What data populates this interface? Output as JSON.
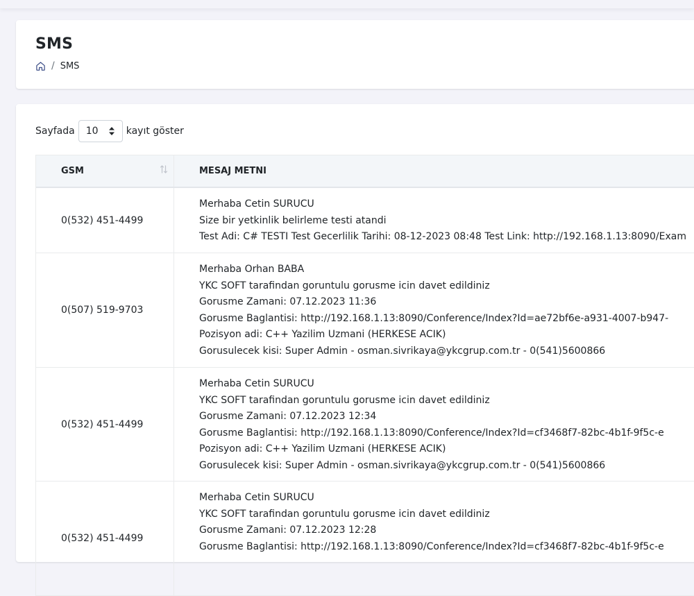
{
  "header": {
    "title": "SMS",
    "breadcrumb": [
      "SMS"
    ]
  },
  "length_menu": {
    "prefix": "Sayfada",
    "selected": "10",
    "suffix": "kayıt göster"
  },
  "table": {
    "columns": [
      "GSM",
      "MESAJ METNI"
    ],
    "rows": [
      {
        "gsm": "0(532) 451-4499",
        "lines": [
          "Merhaba Cetin SURUCU",
          "Size bir yetkinlik belirleme testi atandi",
          "Test Adi: C# TESTI Test Gecerlilik Tarihi: 08-12-2023 08:48 Test Link: http://192.168.1.13:8090/Exam"
        ]
      },
      {
        "gsm": "0(507) 519-9703",
        "lines": [
          "Merhaba Orhan BABA",
          "YKC SOFT tarafindan goruntulu gorusme icin davet edildiniz",
          "Gorusme Zamani: 07.12.2023 11:36",
          "Gorusme Baglantisi: http://192.168.1.13:8090/Conference/Index?Id=ae72bf6e-a931-4007-b947-",
          "Pozisyon adi: C++ Yazilim Uzmani (HERKESE ACIK)",
          "Gorusulecek kisi: Super Admin - osman.sivrikaya@ykcgrup.com.tr - 0(541)5600866"
        ]
      },
      {
        "gsm": "0(532) 451-4499",
        "lines": [
          "Merhaba Cetin SURUCU",
          "YKC SOFT tarafindan goruntulu gorusme icin davet edildiniz",
          "Gorusme Zamani: 07.12.2023 12:34",
          "Gorusme Baglantisi: http://192.168.1.13:8090/Conference/Index?Id=cf3468f7-82bc-4b1f-9f5c-e",
          "Pozisyon adi: C++ Yazilim Uzmani (HERKESE ACIK)",
          "Gorusulecek kisi: Super Admin - osman.sivrikaya@ykcgrup.com.tr - 0(541)5600866"
        ]
      },
      {
        "gsm": "0(532) 451-4499",
        "lines": [
          "Merhaba Cetin SURUCU",
          "YKC SOFT tarafindan goruntulu gorusme icin davet edildiniz",
          "Gorusme Zamani: 07.12.2023 12:28",
          "Gorusme Baglantisi: http://192.168.1.13:8090/Conference/Index?Id=cf3468f7-82bc-4b1f-9f5c-e"
        ]
      }
    ]
  },
  "colors": {
    "background": "#f3f3f9",
    "card": "#ffffff",
    "table_header": "#f3f6f9",
    "home_icon": "#405189"
  },
  "icons": {
    "home": "home-icon",
    "sort": "sort-icon",
    "select": "select-arrows-icon"
  }
}
